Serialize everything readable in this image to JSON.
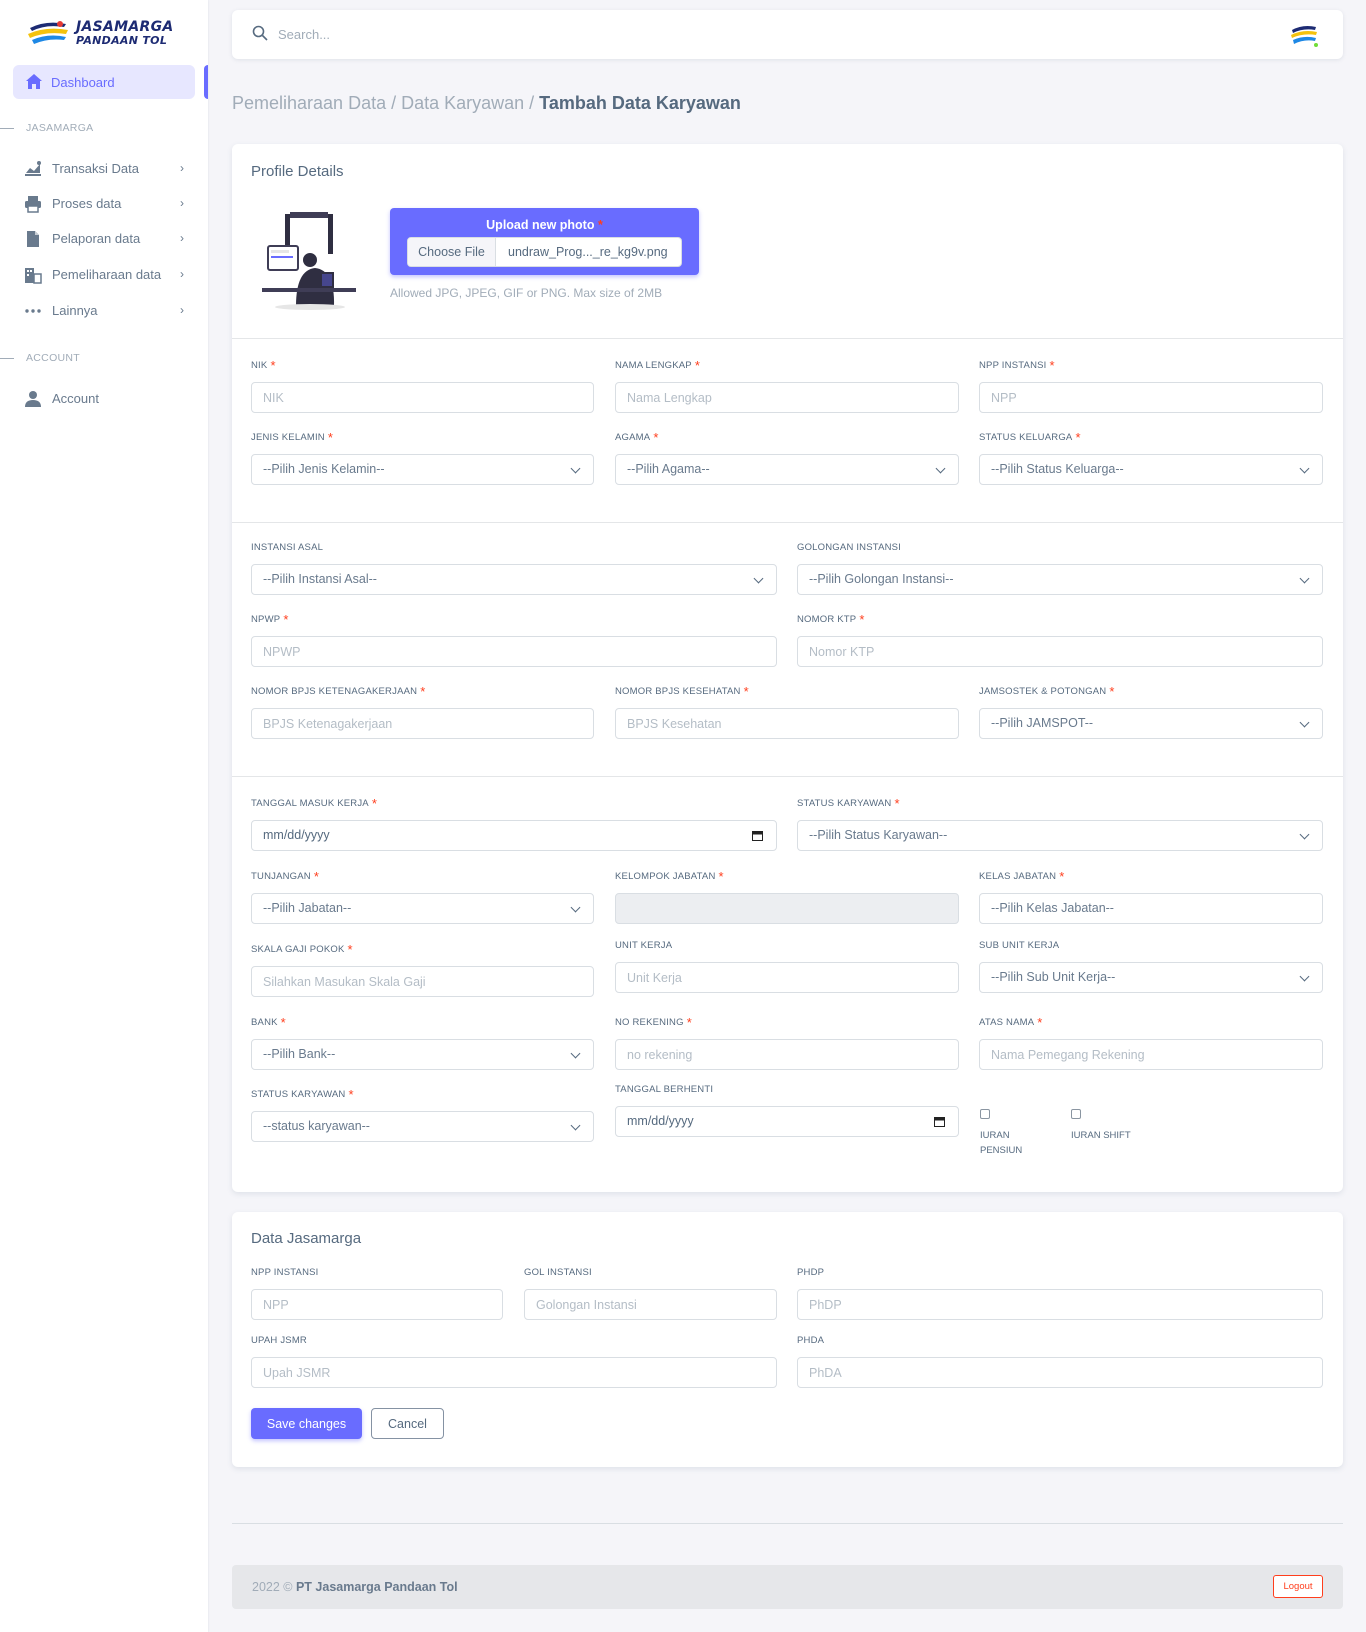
{
  "brand": {
    "line1": "JASAMARGA",
    "line2": "PANDAAN TOL"
  },
  "sidebar": {
    "active": "Dashboard",
    "header1": "JASAMARGA",
    "items": [
      "Transaksi Data",
      "Proses data",
      "Pelaporan data",
      "Pemeliharaan data",
      "Lainnya"
    ],
    "header2": "ACCOUNT",
    "account": "Account"
  },
  "search": {
    "placeholder": "Search..."
  },
  "breadcrumb": {
    "p1": "Pemeliharaan Data / ",
    "p2": "Data Karyawan / ",
    "current": "Tambah Data Karyawan"
  },
  "profile": {
    "title": "Profile Details",
    "upload_label": "Upload new photo",
    "choose_file": "Choose File",
    "file_name": "undraw_Prog..._re_kg9v.png",
    "help": "Allowed JPG, JPEG, GIF or PNG. Max size of 2MB",
    "nik": {
      "label": "NIK",
      "placeholder": "NIK"
    },
    "nama": {
      "label": "NAMA LENGKAP",
      "placeholder": "Nama Lengkap"
    },
    "npp": {
      "label": "NPP INSTANSI",
      "placeholder": "NPP"
    },
    "jenis_kelamin": {
      "label": "JENIS KELAMIN",
      "value": "--Pilih Jenis Kelamin--"
    },
    "agama": {
      "label": "AGAMA",
      "value": "--Pilih Agama--"
    },
    "status_keluarga": {
      "label": "STATUS KELUARGA",
      "value": "--Pilih Status Keluarga--"
    },
    "instansi_asal": {
      "label": "INSTANSI ASAL",
      "value": "--Pilih Instansi Asal--"
    },
    "golongan_instansi": {
      "label": "GOLONGAN INSTANSI",
      "value": "--Pilih Golongan Instansi--"
    },
    "npwp": {
      "label": "NPWP",
      "placeholder": "NPWP"
    },
    "nomor_ktp": {
      "label": "NOMOR KTP",
      "placeholder": "Nomor KTP"
    },
    "bpjs_tk": {
      "label": "NOMOR BPJS KETENAGAKERJAAN",
      "placeholder": "BPJS Ketenagakerjaan"
    },
    "bpjs_kes": {
      "label": "NOMOR BPJS KESEHATAN",
      "placeholder": "BPJS Kesehatan"
    },
    "jamsostek": {
      "label": "JAMSOSTEK & POTONGAN",
      "value": "--Pilih JAMSPOT--"
    },
    "tgl_masuk": {
      "label": "TANGGAL MASUK KERJA",
      "value": "mm/dd/yyyy"
    },
    "status_karyawan_top": {
      "label": "STATUS KARYAWAN",
      "value": "--Pilih Status Karyawan--"
    },
    "tunjangan": {
      "label": "TUNJANGAN",
      "value": "--Pilih Jabatan--"
    },
    "kelompok_jabatan": {
      "label": "KELOMPOK JABATAN"
    },
    "kelas_jabatan": {
      "label": "KELAS JABATAN",
      "value": "--Pilih Kelas Jabatan--"
    },
    "skala_gaji": {
      "label": "SKALA GAJI POKOK",
      "placeholder": "Silahkan Masukan Skala Gaji"
    },
    "unit_kerja": {
      "label": "UNIT KERJA",
      "placeholder": "Unit Kerja"
    },
    "sub_unit": {
      "label": "SUB UNIT KERJA",
      "value": "--Pilih Sub Unit Kerja--"
    },
    "bank": {
      "label": "BANK",
      "value": "--Pilih Bank--"
    },
    "no_rekening": {
      "label": "NO REKENING",
      "placeholder": "no rekening"
    },
    "atas_nama": {
      "label": "ATAS NAMA",
      "placeholder": "Nama Pemegang Rekening"
    },
    "status_karyawan_bottom": {
      "label": "STATUS KARYAWAN",
      "value": "--status karyawan--"
    },
    "tgl_berhenti": {
      "label": "TANGGAL BERHENTI",
      "value": "mm/dd/yyyy"
    },
    "iuran_pensiun": {
      "line1": "IURAN",
      "line2": "PENSIUN"
    },
    "iuran_shift": "IURAN SHIFT"
  },
  "jasamarga": {
    "title": "Data Jasamarga",
    "npp": {
      "label": "NPP INSTANSI",
      "placeholder": "NPP"
    },
    "gol": {
      "label": "GOL INSTANSI",
      "placeholder": "Golongan Instansi"
    },
    "phdp": {
      "label": "PHDP",
      "placeholder": "PhDP"
    },
    "upah": {
      "label": "UPAH JSMR",
      "placeholder": "Upah JSMR"
    },
    "phda": {
      "label": "PHDA",
      "placeholder": "PhDA"
    },
    "save": "Save changes",
    "cancel": "Cancel"
  },
  "footer": {
    "year": "2022 © ",
    "company": "PT Jasamarga Pandaan Tol",
    "logout": "Logout"
  },
  "colors": {
    "primary": "#696cff",
    "danger": "#ff3e1d",
    "text": "#566a7f",
    "online": "#71dd37"
  }
}
